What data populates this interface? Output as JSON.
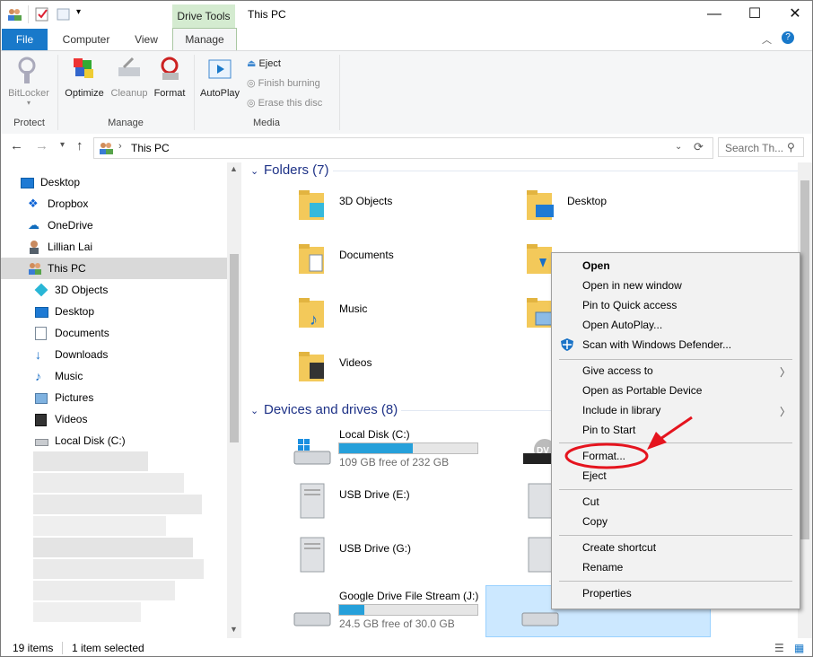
{
  "titlebar": {
    "context_tab": "Drive Tools",
    "window_title": "This PC",
    "minimize": "—",
    "maximize": "☐",
    "close": "✕"
  },
  "ribbon_tabs": {
    "file": "File",
    "computer": "Computer",
    "view": "View",
    "manage": "Manage"
  },
  "ribbon": {
    "bitlocker": "BitLocker",
    "optimize": "Optimize",
    "cleanup": "Cleanup",
    "format": "Format",
    "autoplay": "AutoPlay",
    "eject": "Eject",
    "finish_burning": "Finish burning",
    "erase_disc": "Erase this disc",
    "group_protect": "Protect",
    "group_manage": "Manage",
    "group_media": "Media"
  },
  "address": {
    "path": "This PC",
    "search_placeholder": "Search Th..."
  },
  "nav_pane": {
    "items": [
      {
        "label": "Desktop",
        "icon": "desktop-icon"
      },
      {
        "label": "Dropbox",
        "icon": "dropbox-icon"
      },
      {
        "label": "OneDrive",
        "icon": "onedrive-icon"
      },
      {
        "label": "Lillian Lai",
        "icon": "user-icon"
      },
      {
        "label": "This PC",
        "icon": "this-pc-icon"
      },
      {
        "label": "3D Objects",
        "icon": "3d-objects-icon"
      },
      {
        "label": "Desktop",
        "icon": "desktop-icon"
      },
      {
        "label": "Documents",
        "icon": "documents-icon"
      },
      {
        "label": "Downloads",
        "icon": "downloads-icon"
      },
      {
        "label": "Music",
        "icon": "music-icon"
      },
      {
        "label": "Pictures",
        "icon": "pictures-icon"
      },
      {
        "label": "Videos",
        "icon": "videos-icon"
      },
      {
        "label": "Local Disk (C:)",
        "icon": "local-disk-icon"
      }
    ]
  },
  "content": {
    "folders_header": "Folders (7)",
    "folders": [
      "3D Objects",
      "Desktop",
      "Documents",
      "Music",
      "Videos"
    ],
    "devices_header": "Devices and drives (8)",
    "drives": [
      {
        "name": "Local Disk (C:)",
        "free": "109 GB free of 232 GB",
        "used_fraction": 0.53
      },
      {
        "name": "USB Drive (E:)"
      },
      {
        "name": "USB Drive (G:)"
      },
      {
        "name": "Google Drive File Stream (J:)",
        "free": "24.5 GB free of 30.0 GB",
        "used_fraction": 0.18
      }
    ],
    "dvd_label": "DV"
  },
  "context_menu": {
    "open": "Open",
    "open_new_window": "Open in new window",
    "pin_quick": "Pin to Quick access",
    "open_autoplay": "Open AutoPlay...",
    "scan_defender": "Scan with Windows Defender...",
    "give_access": "Give access to",
    "open_portable": "Open as Portable Device",
    "include_library": "Include in library",
    "pin_start": "Pin to Start",
    "format": "Format...",
    "eject": "Eject",
    "cut": "Cut",
    "copy": "Copy",
    "create_shortcut": "Create shortcut",
    "rename": "Rename",
    "properties": "Properties"
  },
  "status": {
    "items_count": "19 items",
    "selected": "1 item selected"
  },
  "colors": {
    "accent_blue": "#1979ca",
    "drive_bar": "#26a0da",
    "annotation_red": "#e5141e",
    "selection": "#cce8ff"
  }
}
